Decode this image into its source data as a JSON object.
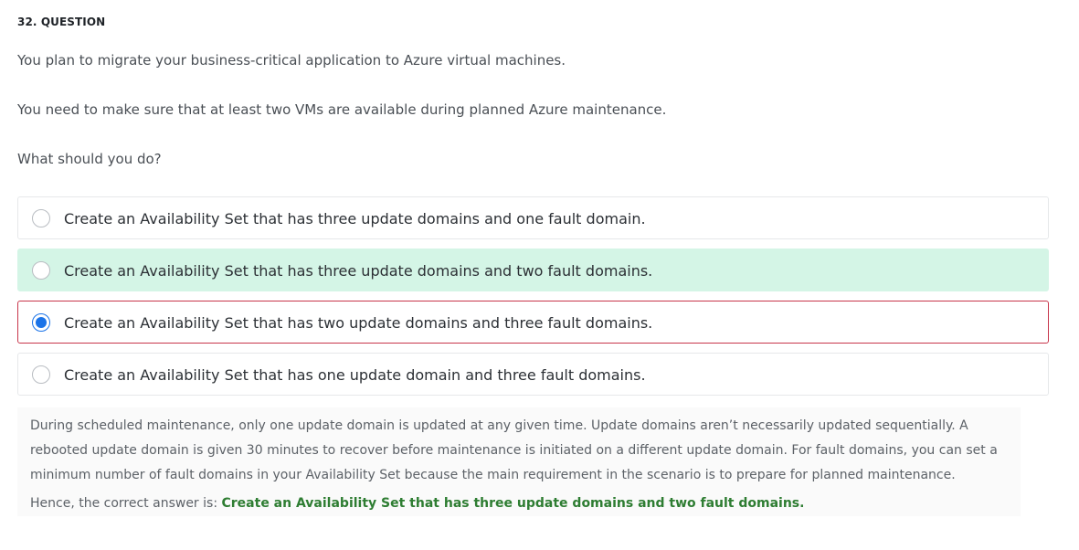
{
  "question": {
    "number_label": "32. QUESTION",
    "paragraphs": [
      "You plan to migrate your business-critical application to Azure virtual machines.",
      "You need to make sure that at least two VMs are available during planned Azure maintenance.",
      "What should you do?"
    ]
  },
  "options": [
    {
      "label": "Create an Availability Set that has three update domains and one fault domain.",
      "selected": false,
      "correct": false
    },
    {
      "label": "Create an Availability Set that has three update domains and two fault domains.",
      "selected": false,
      "correct": true
    },
    {
      "label": "Create an Availability Set that has two update domains and three fault domains.",
      "selected": true,
      "correct": false
    },
    {
      "label": "Create an Availability Set that has one update domain and three fault domains.",
      "selected": false,
      "correct": false
    }
  ],
  "explanation": {
    "text": "During scheduled maintenance, only one update domain is updated at any given time. Update domains aren’t necessarily updated sequentially. A rebooted update domain is given 30 minutes to recover before maintenance is initiated on a different update domain. For fault domains, you can set a minimum number of fault domains in your Availability Set because the main requirement in the scenario is to prepare for planned maintenance.",
    "answer_prefix": "Hence, the correct answer is: ",
    "answer_text": "Create an Availability Set that has three update domains and two fault domains."
  },
  "colors": {
    "correct_background": "#d4f5e6",
    "selected_border": "#c8364b",
    "radio_accent": "#1a73e8",
    "answer_green": "#2e7d32"
  }
}
